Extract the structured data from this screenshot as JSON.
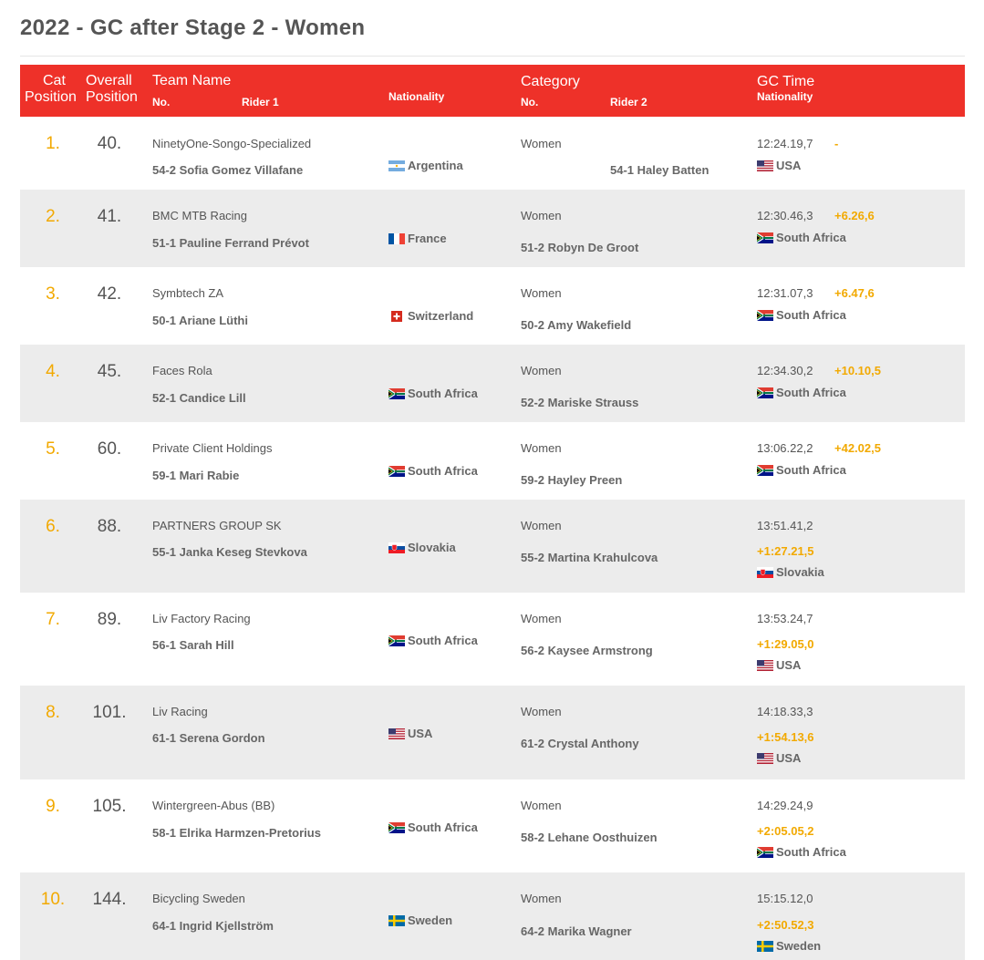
{
  "title": "2022 - GC after Stage 2 - Women",
  "headers": {
    "cat_position_1": "Cat",
    "cat_position_2": "Position",
    "overall_position_1": "Overall",
    "overall_position_2": "Position",
    "team_name": "Team Name",
    "no_1": "No.",
    "rider_1": "Rider 1",
    "nationality_1": "Nationality",
    "category": "Category",
    "no_2": "No.",
    "rider_2": "Rider 2",
    "gc_time": "GC Time",
    "nationality_2": "Nationality"
  },
  "rows": [
    {
      "cat_pos": "1.",
      "overall": "40.",
      "team": "NinetyOne-Songo-Specialized",
      "rider1": "54-2 Sofia Gomez Villafane",
      "nat1": "Argentina",
      "flag1": "argentina-flag",
      "category": "Women",
      "rider2": "54-1 Haley Batten",
      "gc_time": "12:24.19,7",
      "gap": "-",
      "nat2": "USA",
      "flag2": "usa-flag"
    },
    {
      "cat_pos": "2.",
      "overall": "41.",
      "team": "BMC MTB Racing",
      "rider1": "51-1 Pauline Ferrand Prévot",
      "nat1": "France",
      "flag1": "france-flag",
      "category": "Women",
      "rider2": "51-2 Robyn De Groot",
      "gc_time": "12:30.46,3",
      "gap": "+6.26,6",
      "nat2": "South Africa",
      "flag2": "south-africa-flag"
    },
    {
      "cat_pos": "3.",
      "overall": "42.",
      "team": "Symbtech ZA",
      "rider1": "50-1 Ariane Lüthi",
      "nat1": "Switzerland",
      "flag1": "switzerland-flag",
      "category": "Women",
      "rider2": "50-2 Amy Wakefield",
      "gc_time": "12:31.07,3",
      "gap": "+6.47,6",
      "nat2": "South Africa",
      "flag2": "south-africa-flag"
    },
    {
      "cat_pos": "4.",
      "overall": "45.",
      "team": "Faces Rola",
      "rider1": "52-1 Candice Lill",
      "nat1": "South Africa",
      "flag1": "south-africa-flag",
      "category": "Women",
      "rider2": "52-2 Mariske Strauss",
      "gc_time": "12:34.30,2",
      "gap": "+10.10,5",
      "nat2": "South Africa",
      "flag2": "south-africa-flag"
    },
    {
      "cat_pos": "5.",
      "overall": "60.",
      "team": "Private Client Holdings",
      "rider1": "59-1 Mari Rabie",
      "nat1": "South Africa",
      "flag1": "south-africa-flag",
      "category": "Women",
      "rider2": "59-2 Hayley Preen",
      "gc_time": "13:06.22,2",
      "gap": "+42.02,5",
      "nat2": "South Africa",
      "flag2": "south-africa-flag"
    },
    {
      "cat_pos": "6.",
      "overall": "88.",
      "team": "PARTNERS GROUP SK",
      "rider1": "55-1 Janka Keseg Stevkova",
      "nat1": "Slovakia",
      "flag1": "slovakia-flag",
      "category": "Women",
      "rider2": "55-2 Martina Krahulcova",
      "gc_time": "13:51.41,2",
      "gap": "+1:27.21,5",
      "nat2": "Slovakia",
      "flag2": "slovakia-flag"
    },
    {
      "cat_pos": "7.",
      "overall": "89.",
      "team": "Liv Factory Racing",
      "rider1": "56-1 Sarah Hill",
      "nat1": "South Africa",
      "flag1": "south-africa-flag",
      "category": "Women",
      "rider2": "56-2 Kaysee Armstrong",
      "gc_time": "13:53.24,7",
      "gap": "+1:29.05,0",
      "nat2": "USA",
      "flag2": "usa-flag"
    },
    {
      "cat_pos": "8.",
      "overall": "101.",
      "team": "Liv Racing",
      "rider1": "61-1 Serena Gordon",
      "nat1": "USA",
      "flag1": "usa-flag",
      "category": "Women",
      "rider2": "61-2 Crystal Anthony",
      "gc_time": "14:18.33,3",
      "gap": "+1:54.13,6",
      "nat2": "USA",
      "flag2": "usa-flag"
    },
    {
      "cat_pos": "9.",
      "overall": "105.",
      "team": "Wintergreen-Abus (BB)",
      "rider1": "58-1 Elrika Harmzen-Pretorius",
      "nat1": "South Africa",
      "flag1": "south-africa-flag",
      "category": "Women",
      "rider2": "58-2 Lehane Oosthuizen",
      "gc_time": "14:29.24,9",
      "gap": "+2:05.05,2",
      "nat2": "South Africa",
      "flag2": "south-africa-flag"
    },
    {
      "cat_pos": "10.",
      "overall": "144.",
      "team": "Bicycling Sweden",
      "rider1": "64-1 Ingrid Kjellström",
      "nat1": "Sweden",
      "flag1": "sweden-flag",
      "category": "Women",
      "rider2": "64-2 Marika Wagner",
      "gc_time": "15:15.12,0",
      "gap": "+2:50.52,3",
      "nat2": "Sweden",
      "flag2": "sweden-flag"
    }
  ]
}
